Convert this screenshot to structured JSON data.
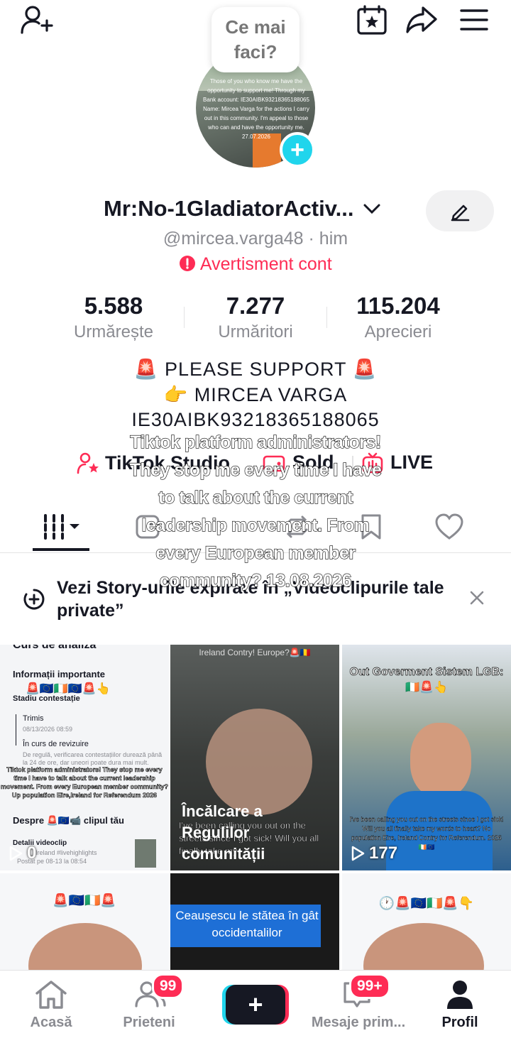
{
  "header": {
    "bubble_text": "Ce mai faci?",
    "avatar_caption": "Those of you who know me have the opportunity to support me! Through my Bank account: IE30AIBK93218365188065 Name: Mircea Varga for the actions I carry out in this community. I'm appeal to those who can and have the opportunity me. 27.07.2026"
  },
  "profile": {
    "name": "Mr:No-1GladiatorActiv...",
    "handle": "@mircea.varga48 · him",
    "warning": "Avertisment cont",
    "stats": [
      {
        "value": "5.588",
        "label": "Urmărește"
      },
      {
        "value": "7.277",
        "label": "Urmăritori"
      },
      {
        "value": "115.204",
        "label": "Aprecieri"
      }
    ],
    "bio_line1": "🚨 PLEASE SUPPORT 🚨",
    "bio_line2": "👉 MIRCEA VARGA",
    "bio_line3": "IE30AIBK93218365188065",
    "links": {
      "studio": "TikTok Studio",
      "sold": "Sold",
      "live": "LIVE"
    }
  },
  "overlay_caption": "Tiktok platform administrators! They stop me every time I have to talk about the current leadership movement. From every European member community? 13.08.2026",
  "banner": {
    "text": "Vezi Story-urile expirate în „Videoclipurile tale private”"
  },
  "grid": {
    "cell1": {
      "header_text": "Curs de analiză",
      "info_title": "Informații importante",
      "emojis": "🚨🇪🇺🇮🇪🇪🇺🚨👆",
      "stage_title": "Stadiu contestație",
      "sent": "Trimis",
      "sent_date": "08/13/2026 08:59",
      "review": "În curs de revizuire",
      "review_desc": "De regulă, verificarea contestațiilor durează până la 24 de ore, dar uneori poate dura mai mult.",
      "caption": "Tiktok platform administrators! They stop me every time I have to talk about the current leadership movement. From every European member community? Up population Eire,Ireland for Referendum 2026",
      "about": "Despre 🚨🇪🇺📹 clipul tău",
      "detail": "Detalii videoclip",
      "tags": "Ireland #livehighlights",
      "posted": "Postat pe 08-13 la 08:54",
      "plays": "0"
    },
    "cell2": {
      "top_text": "Ireland Contry! Europe?🚨🇷🇴",
      "title": "Încălcare a Regulilor comunității",
      "subtitle": "I've been calling you out on the streets since I got sick! Will you all finally take my"
    },
    "cell3": {
      "top_text": "Out Goverment Sistem LGB:🇮🇪🚨👆",
      "caption": "I've been calling you out on the streets since I got sick! Will you all finally take my words to heart? No population Eire, Ireland Contry for Referendum. 2026🇮🇪🇪🇺",
      "plays": "177"
    },
    "cell4": {
      "top_text": "🚨🇪🇺🇮🇪🚨"
    },
    "cell5": {
      "title": "Ceaușescu le stătea în gât occidentalilor"
    },
    "cell6": {
      "top_text": "🕐🚨🇪🇺🇮🇪🚨👇"
    }
  },
  "nav": {
    "home": "Acasă",
    "friends": "Prieteni",
    "friends_badge": "99",
    "inbox": "Mesaje prim...",
    "inbox_badge": "99+",
    "profile": "Profil"
  },
  "colors": {
    "accent_red": "#fe2c55",
    "accent_cyan": "#20d5ec",
    "text_dark": "#161823",
    "text_grey": "#8a8b91"
  }
}
